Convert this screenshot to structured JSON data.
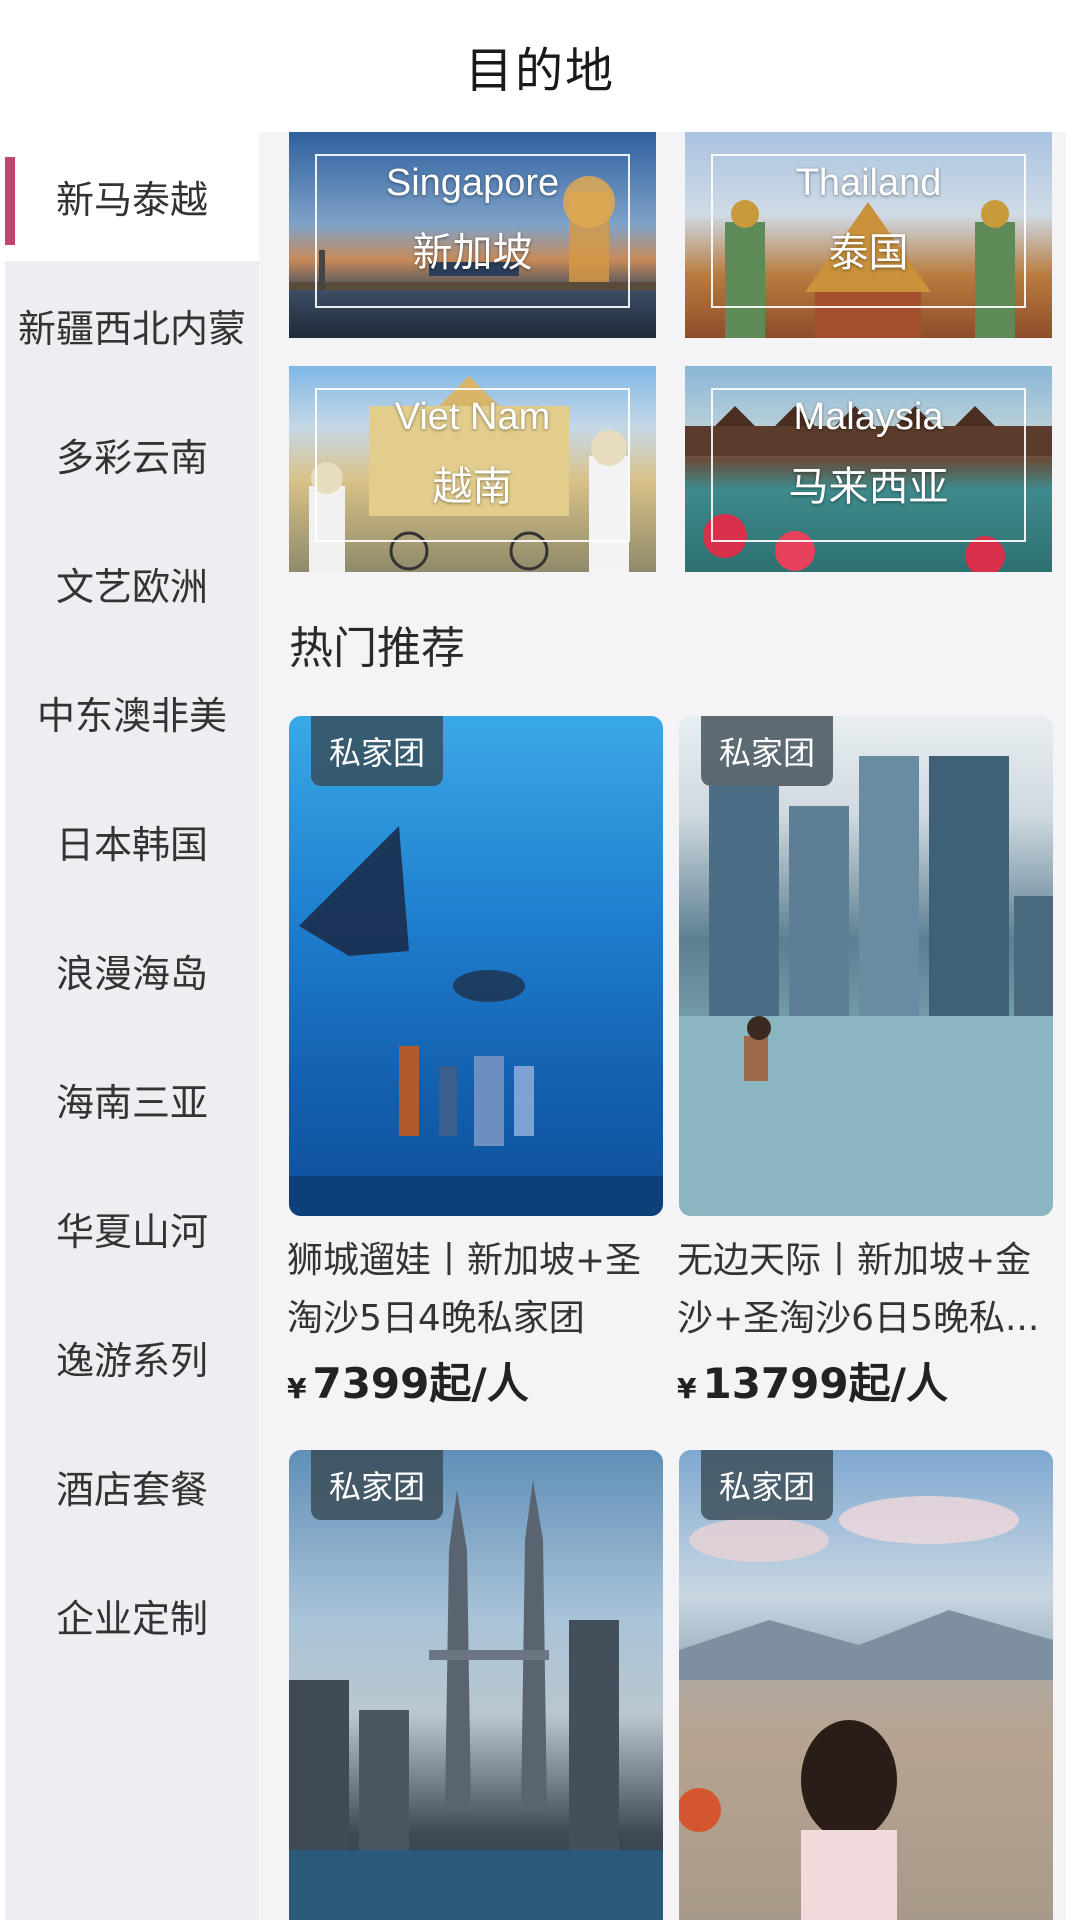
{
  "header": {
    "title": "目的地"
  },
  "sidebar": {
    "items": [
      {
        "label": "新马泰越",
        "active": true
      },
      {
        "label": "新疆西北内蒙"
      },
      {
        "label": "多彩云南"
      },
      {
        "label": "文艺欧洲"
      },
      {
        "label": "中东澳非美"
      },
      {
        "label": "日本韩国"
      },
      {
        "label": "浪漫海岛"
      },
      {
        "label": "海南三亚"
      },
      {
        "label": "华夏山河"
      },
      {
        "label": "逸游系列"
      },
      {
        "label": "酒店套餐"
      },
      {
        "label": "企业定制"
      }
    ]
  },
  "destinations": [
    {
      "en": "Singapore",
      "cn": "新加坡"
    },
    {
      "en": "Thailand",
      "cn": "泰国"
    },
    {
      "en": "Viet Nam",
      "cn": "越南"
    },
    {
      "en": "Malaysia",
      "cn": "马来西亚"
    }
  ],
  "section": {
    "title": "热门推荐"
  },
  "products": [
    {
      "badge": "私家团",
      "name_line1": "狮城遛娃丨新加坡+圣",
      "name_line2": "淘沙5日4晚私家团",
      "currency": "¥",
      "price": "7399起/人"
    },
    {
      "badge": "私家团",
      "name_line1": "无边天际丨新加坡+金",
      "name_line2": "沙+圣淘沙6日5晚私...",
      "currency": "¥",
      "price": "13799起/人"
    },
    {
      "badge": "私家团"
    },
    {
      "badge": "私家团"
    }
  ],
  "colors": {
    "accent": "#c2456f",
    "sidebar_bg": "#eeeef2",
    "main_bg": "#f4f4f6"
  }
}
